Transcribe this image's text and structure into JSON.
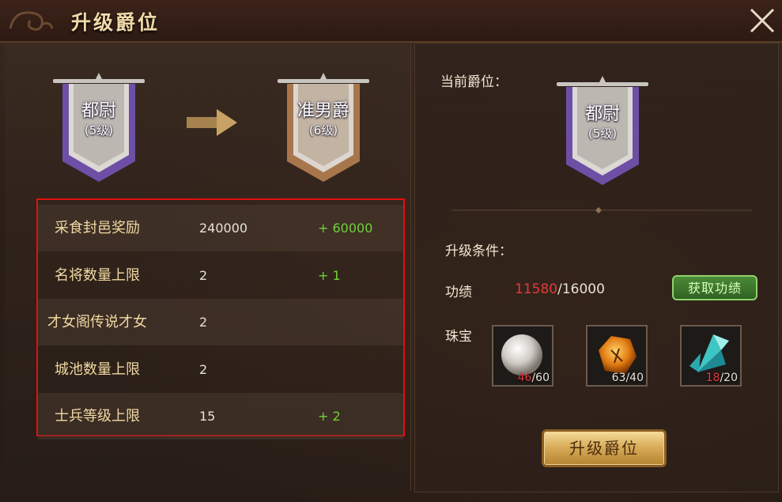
{
  "window": {
    "title": "升级爵位"
  },
  "promotion": {
    "current": {
      "name": "都尉",
      "level": "(5级)"
    },
    "next": {
      "name": "准男爵",
      "level": "(6级)"
    }
  },
  "stats": [
    {
      "label": "采食封邑奖励",
      "value": "240000",
      "increase": "+ 60000"
    },
    {
      "label": "名将数量上限",
      "value": "2",
      "increase": "+ 1"
    },
    {
      "label": "才女阁传说才女",
      "value": "2",
      "increase": ""
    },
    {
      "label": "城池数量上限",
      "value": "2",
      "increase": ""
    },
    {
      "label": "士兵等级上限",
      "value": "15",
      "increase": "+ 2"
    }
  ],
  "right": {
    "current_title_label": "当前爵位：",
    "current": {
      "name": "都尉",
      "level": "(5级)"
    },
    "conditions_label": "升级条件：",
    "merit_label": "功绩",
    "merit_current": "11580",
    "merit_sep": "/",
    "merit_required": "16000",
    "get_merit_button": "获取功绩",
    "jewel_label": "珠宝",
    "jewels": [
      {
        "name": "pearl",
        "current": "46",
        "sep": "/",
        "required": "60"
      },
      {
        "name": "amber",
        "current": "63",
        "sep": "/",
        "required": "40"
      },
      {
        "name": "crystal",
        "current": "18",
        "sep": "/",
        "required": "20"
      }
    ],
    "upgrade_button": "升级爵位"
  },
  "colors": {
    "accent_gold": "#f1d9a2",
    "increase_green": "#6ed13b",
    "insufficient_red": "#e23b3b",
    "highlight_box": "#e01010"
  }
}
